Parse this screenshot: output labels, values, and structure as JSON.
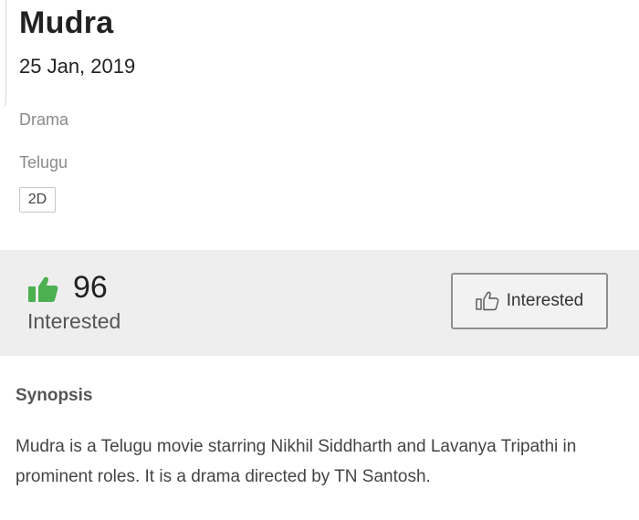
{
  "movie": {
    "title": "Mudra",
    "release_date": "25 Jan, 2019",
    "genre": "Drama",
    "language": "Telugu",
    "format": "2D"
  },
  "interest": {
    "count": "96",
    "label": "Interested",
    "button_label": "Interested",
    "icon": "thumbs-up-icon",
    "icon_color": "#4caf50"
  },
  "synopsis": {
    "heading": "Synopsis",
    "text": "Mudra is a Telugu movie starring Nikhil Siddharth and Lavanya Tripathi in prominent roles. It is a drama directed by TN Santosh."
  }
}
